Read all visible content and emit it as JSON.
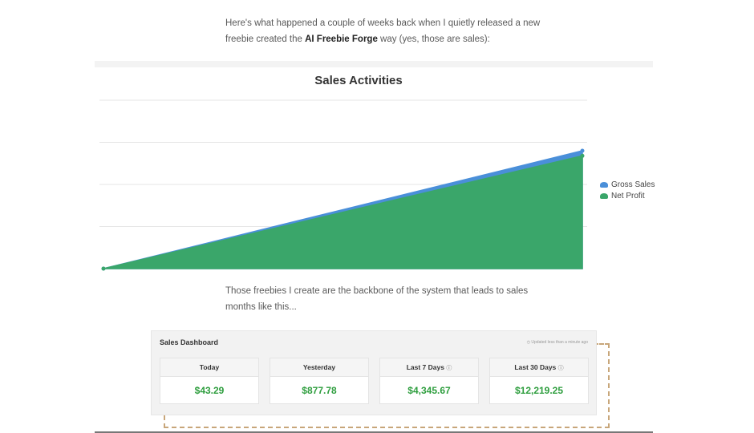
{
  "intro": {
    "line1": "Here's what happened a couple of weeks back when I quietly released a new",
    "line2_pre": "freebie created the ",
    "line2_bold": "AI Freebie Forge",
    "line2_post": " way (yes, those are sales):"
  },
  "outro": {
    "line1": "Those freebies I create are the backbone of the system that leads to sales",
    "line2": "months like this..."
  },
  "colors": {
    "gross": "#4a8fd9",
    "net": "#3aa66a",
    "money": "#2e9e3e"
  },
  "chart_data": {
    "type": "area",
    "title": "Sales Activities",
    "x": [
      0,
      1
    ],
    "ylim": [
      0,
      100
    ],
    "grid": true,
    "legend_position": "right",
    "series": [
      {
        "name": "Gross Sales",
        "values": [
          0,
          70
        ]
      },
      {
        "name": "Net Profit",
        "values": [
          0,
          67
        ]
      }
    ]
  },
  "dashboard": {
    "title": "Sales Dashboard",
    "updated": "Updated less than a minute ago",
    "cards": [
      {
        "label": "Today",
        "value": "$43.29",
        "info": false
      },
      {
        "label": "Yesterday",
        "value": "$877.78",
        "info": false
      },
      {
        "label": "Last 7 Days",
        "value": "$4,345.67",
        "info": true
      },
      {
        "label": "Last 30 Days",
        "value": "$12,219.25",
        "info": true
      }
    ]
  }
}
